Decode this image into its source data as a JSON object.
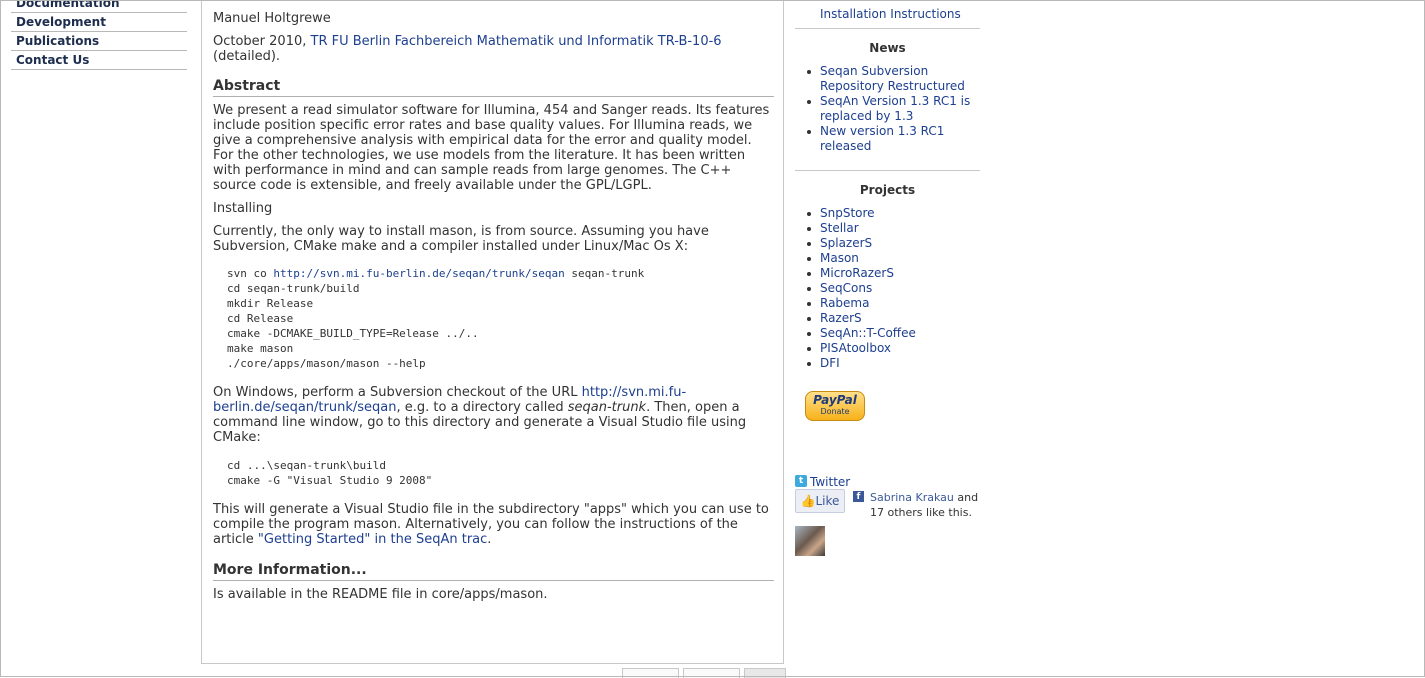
{
  "leftnav": {
    "items": [
      "Documentation",
      "Development",
      "Publications",
      "Contact Us"
    ]
  },
  "main": {
    "author": "Manuel Holtgrewe",
    "citation_date": "October 2010,",
    "citation_link": "TR FU Berlin Fachbereich Mathematik und Informatik TR-B-10-6",
    "citation_suffix": "(detailed).",
    "abstract_heading": "Abstract",
    "abstract_text": "We present a read simulator software for Illumina, 454 and Sanger reads. Its features include position specific error rates and base quality values. For Illumina reads, we give a comprehensive analysis with empirical data for the error and quality model. For the other technologies, we use models from the literature. It has been written with performance in mind and can sample reads from large genomes. The C++ source code is extensible, and freely available under the GPL/LGPL.",
    "installing_label": "Installing",
    "install_intro": "Currently, the only way to install mason, is from source. Assuming you have Subversion, CMake make and a compiler installed under Linux/Mac Os X:",
    "code1": {
      "l1_pre": "svn co ",
      "l1_link": "http://svn.mi.fu-berlin.de/seqan/trunk/seqan",
      "l1_post": " seqan-trunk",
      "rest": "cd seqan-trunk/build\nmkdir Release\ncd Release\ncmake -DCMAKE_BUILD_TYPE=Release ../..\nmake mason\n./core/apps/mason/mason --help"
    },
    "windows_pre": "On Windows, perform a Subversion checkout of the URL",
    "windows_link": "http://svn.mi.fu-berlin.de/seqan/trunk/seqan",
    "windows_mid": ", e.g. to a directory called",
    "windows_dir": "seqan-trunk",
    "windows_post": ". Then, open a command line window, go to this directory and generate a Visual Studio file using CMake:",
    "code2": "cd ...\\seqan-trunk\\build\ncmake -G \"Visual Studio 9 2008\"",
    "vs_pre": "This will generate a Visual Studio file in the subdirectory \"apps\" which you can use to compile the program mason. Alternatively, you can follow the instructions of the article",
    "vs_link": "\"Getting Started\" in the SeqAn trac",
    "vs_post": ".",
    "more_heading": "More Information...",
    "more_text": "Is available in the README file in core/apps/mason."
  },
  "sidebar": {
    "install_link": "Installation Instructions",
    "news_heading": "News",
    "news": [
      "Seqan Subversion Repository Restructured",
      "SeqAn Version 1.3 RC1 is replaced by 1.3",
      "New version 1.3 RC1 released"
    ],
    "projects_heading": "Projects",
    "projects": [
      "SnpStore",
      "Stellar",
      "SplazerS",
      "Mason",
      "MicroRazerS",
      "SeqCons",
      "Rabema",
      "RazerS",
      "SeqAn::T-Coffee",
      "PISAtoolbox",
      "DFI"
    ],
    "paypal_label": "PayPal",
    "paypal_sub": "Donate",
    "twitter_label": "Twitter",
    "like_label": "Like",
    "fb_name": "Sabrina Krakau",
    "fb_rest": " and 17 others like this."
  }
}
